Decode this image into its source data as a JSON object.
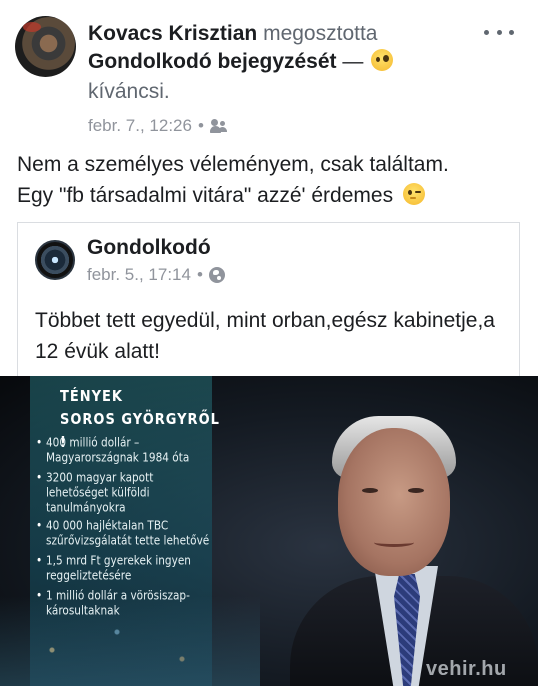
{
  "post": {
    "author": "Kovacs Krisztian",
    "shared_verb": "megosztotta",
    "shared_link": "Gondolkodó bejegyzését",
    "feeling_dash": "—",
    "feeling_emoji": "curious-emoji",
    "feeling": "kíváncsi.",
    "date": "febr. 7., 12:26",
    "separator": "•",
    "audience_icon": "friends-icon",
    "more_icon": "more-options-icon",
    "text_line1": "Nem a személyes véleményem, csak találtam.",
    "text_line2": "Egy  \"fb társadalmi vitára\" azzé' érdemes",
    "text_emoji": "wink-emoji"
  },
  "shared": {
    "author": "Gondolkodó",
    "date": "febr. 5., 17:14",
    "separator": "•",
    "audience_icon": "globe-icon",
    "text": "Többet tett egyedül, mint orban,egész kabinetje,a 12 évük alatt!"
  },
  "image": {
    "title_line1": "TÉNYEK",
    "title_line2": "SOROS GYÖRGYRŐL !",
    "facts": [
      "400 millió dollár – Magyarországnak 1984 óta",
      "3200 magyar kapott lehetőséget külföldi tanulmányokra",
      "40 000 hajléktalan TBC szűrővizsgálatát tette lehetővé",
      "1,5 mrd Ft gyerekek ingyen reggeliztetésére",
      "1 millió dollár a vörösiszap-károsultaknak"
    ],
    "watermark": "vehir.hu"
  }
}
